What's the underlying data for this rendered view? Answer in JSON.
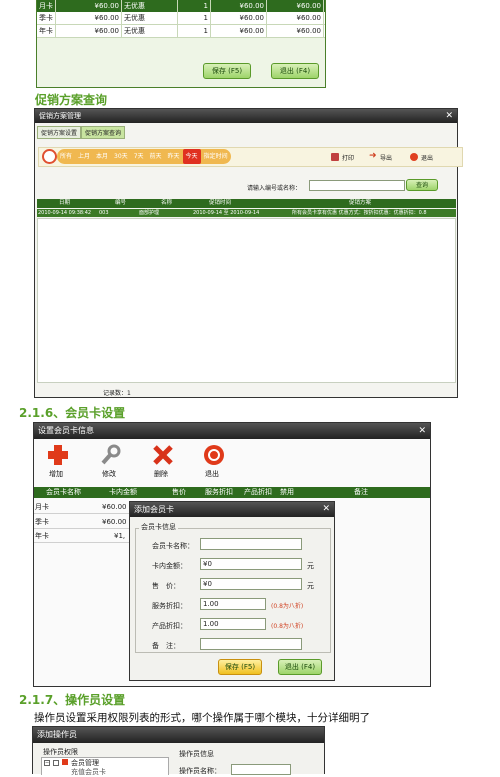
{
  "top_table": {
    "rows": [
      {
        "name": "月卡",
        "amount": "¥60.00",
        "discount": "无优惠",
        "count": "1",
        "price": "¥60.00",
        "total": "¥60.00"
      },
      {
        "name": "季卡",
        "amount": "¥60.00",
        "discount": "无优惠",
        "count": "1",
        "price": "¥60.00",
        "total": "¥60.00"
      },
      {
        "name": "年卡",
        "amount": "¥60.00",
        "discount": "无优惠",
        "count": "1",
        "price": "¥60.00",
        "total": "¥60.00"
      }
    ],
    "save_label": "保存 (F5)",
    "exit_label": "退出 (F4)"
  },
  "promo": {
    "heading": "促销方案查询",
    "title": "促销方案管理",
    "tabs": [
      "促销方案设置",
      "促销方案查询"
    ],
    "date_filters": [
      "所有",
      "上月",
      "本月",
      "30天",
      "7天",
      "前天",
      "昨天",
      "今天",
      "指定时间"
    ],
    "actions": {
      "print": "打印",
      "export": "导出",
      "exit": "退出"
    },
    "search_label": "请输入编号或名称：",
    "search_value": "",
    "query_label": "查询",
    "columns": [
      "日期",
      "编号",
      "名称",
      "促销时间",
      "促销方案"
    ],
    "row": {
      "date": "2010-09-14 09:38:42",
      "code": "003",
      "name": "面部护理",
      "time": "2010-09-14 至 2010-09-14",
      "scheme": "所有会员卡享有优惠  优惠方式：按折扣优惠：优惠折扣：0.8"
    },
    "record_count": "记录数：1"
  },
  "member_card": {
    "heading": "2.1.6、会员卡设置",
    "title": "设置会员卡信息",
    "tools": [
      "增加",
      "修改",
      "删除",
      "退出"
    ],
    "columns": [
      "会员卡名称",
      "卡内金额",
      "售价",
      "服务折扣",
      "产品折扣",
      "禁用",
      "备注"
    ],
    "rows": [
      {
        "name": "月卡",
        "amount": "¥60.00"
      },
      {
        "name": "季卡",
        "amount": "¥60.00"
      },
      {
        "name": "年卡",
        "amount": "¥1,"
      }
    ],
    "dialog": {
      "title": "添加会员卡",
      "group": "会员卡信息",
      "fields": {
        "name_label": "会员卡名称：",
        "name_value": "",
        "amount_label": "卡内金额：",
        "amount_value": "¥0",
        "amount_unit": "元",
        "price_label": "售　价：",
        "price_value": "¥0",
        "price_unit": "元",
        "service_label": "服务折扣：",
        "service_value": "1.00",
        "service_hint": "(0.8为八折)",
        "product_label": "产品折扣：",
        "product_value": "1.00",
        "product_hint": "(0.8为八折)",
        "note_label": "备　注：",
        "note_value": ""
      },
      "save_label": "保存 (F5)",
      "exit_label": "退出 (F4)"
    }
  },
  "operator": {
    "heading": "2.1.7、操作员设置",
    "description": "操作员设置采用权限列表的形式，哪个操作属于哪个模块，十分详细明了",
    "title": "添加操作员",
    "perm_label": "操作员权限",
    "tree_item1": "会员管理",
    "tree_item2": "充值会员卡",
    "info_label": "操作员信息",
    "field_label": "操作员名称："
  }
}
